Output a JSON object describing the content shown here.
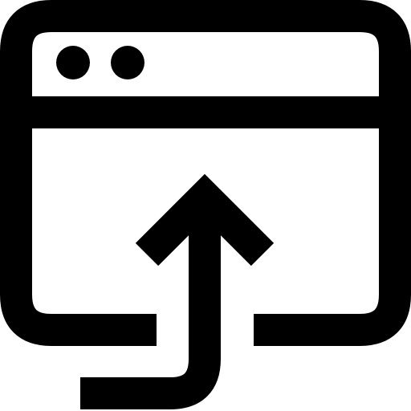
{
  "icon": {
    "name": "browser-upload-icon",
    "color": "#000000",
    "background": "#ffffff",
    "window_dots": 2,
    "arrow_direction": "up"
  }
}
